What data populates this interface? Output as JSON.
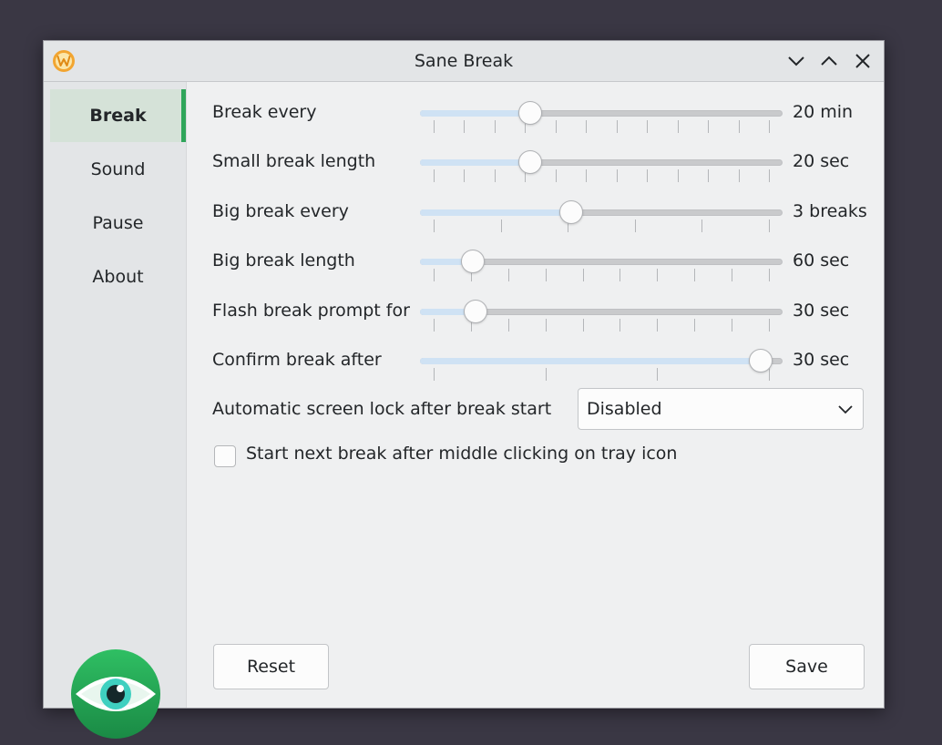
{
  "window": {
    "title": "Sane Break",
    "app_icon": "w-icon",
    "controls": [
      "minimize-icon",
      "maximize-icon",
      "close-icon"
    ]
  },
  "sidebar": {
    "items": [
      {
        "label": "Break",
        "active": true
      },
      {
        "label": "Sound",
        "active": false
      },
      {
        "label": "Pause",
        "active": false
      },
      {
        "label": "About",
        "active": false
      }
    ],
    "logo": "eye-icon"
  },
  "settings": {
    "sliders": [
      {
        "label": "Break every",
        "value": "20 min",
        "position": 0.29
      },
      {
        "label": "Small break length",
        "value": "20 sec",
        "position": 0.29
      },
      {
        "label": "Big break every",
        "value": "3 breaks",
        "position": 0.41
      },
      {
        "label": "Big break length",
        "value": "60 sec",
        "position": 0.12
      },
      {
        "label": "Flash break prompt for",
        "value": "30 sec",
        "position": 0.13
      },
      {
        "label": "Confirm break after",
        "value": "30 sec",
        "position": 0.97
      }
    ],
    "screen_lock": {
      "label": "Automatic screen lock after break start",
      "value": "Disabled"
    },
    "middle_click": {
      "label": "Start next break after middle clicking on tray icon",
      "checked": false
    }
  },
  "buttons": {
    "reset": "Reset",
    "save": "Save"
  },
  "colors": {
    "accent": "#2fa55a",
    "slider_fill": "#cfe2f4",
    "background": "#3a3744"
  }
}
